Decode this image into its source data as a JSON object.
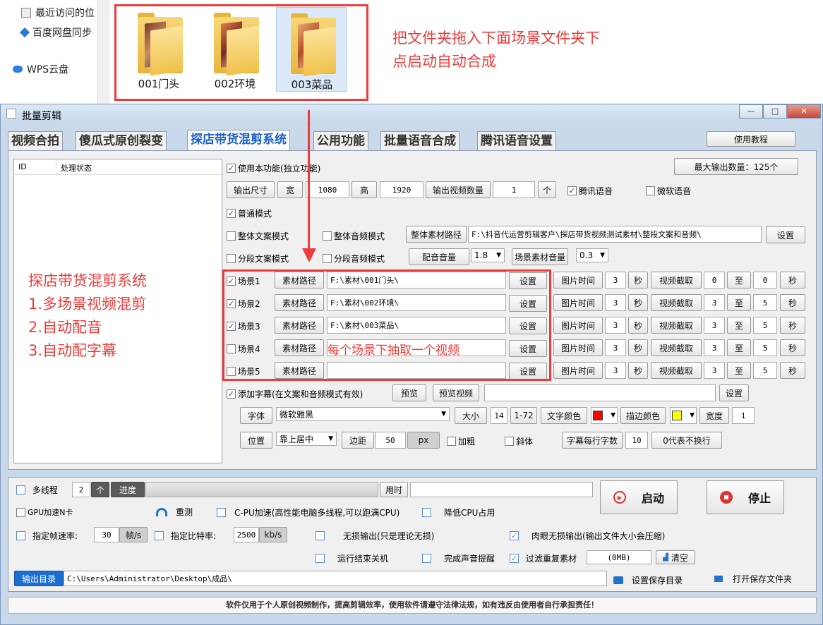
{
  "explorer": {
    "nav": [
      {
        "label": "最近访问的位"
      },
      {
        "label": "百度网盘同步"
      },
      {
        "label": "WPS云盘"
      }
    ],
    "folders": [
      {
        "label": "001门头"
      },
      {
        "label": "002环境"
      },
      {
        "label": "003菜品"
      }
    ]
  },
  "annotations": {
    "top_line1": "把文件夹拖入下面场景文件夹下",
    "top_line2": "点启动自动合成",
    "left_line1": "探店带货混剪系统",
    "left_line2": "1.多场景视频混剪",
    "left_line3": "2.自动配音",
    "left_line4": "3.自动配字幕",
    "scene_note": "每个场景下抽取一个视频"
  },
  "window": {
    "title": "批量剪辑",
    "controls": [
      "—",
      "□",
      "✕"
    ]
  },
  "tabs": [
    {
      "label": "视频合拍"
    },
    {
      "label": "傻瓜式原创裂变"
    },
    {
      "label": "探店带货混剪系统"
    },
    {
      "label": "公用功能"
    },
    {
      "label": "批量语音合成"
    },
    {
      "label": "腾讯语音设置"
    }
  ],
  "tutorial_button": "使用教程",
  "list": {
    "col_id": "ID",
    "col_status": "处理状态"
  },
  "main": {
    "enable_label": "使用本功能(独立功能)",
    "max_output": "最大输出数量：125个",
    "output_size": "输出尺寸",
    "width_label": "宽",
    "width_value": "1080",
    "height_label": "高",
    "height_value": "1920",
    "video_count_label": "输出视频数量",
    "video_count_value": "1",
    "count_unit": "个",
    "tencent_voice": "腾讯语音",
    "ms_voice": "微软语音",
    "normal_mode": "普通模式",
    "whole_text_mode": "整体文案模式",
    "whole_audio_mode": "整体音频模式",
    "whole_path_btn": "整体素材路径",
    "whole_path_value": "F:\\抖音代运营剪辑客户\\探店带货视频测试素材\\整段文案和音频\\",
    "settings": "设置",
    "seg_text_mode": "分段文案模式",
    "seg_audio_mode": "分段音频模式",
    "dub_volume": "配音音量",
    "dub_volume_value": "1.8",
    "scene_volume": "场景素材音量",
    "scene_volume_value": "0.3"
  },
  "scenes": [
    {
      "label": "场景1",
      "checked": true,
      "path": "F:\\素材\\001门头\\",
      "img_time": "3",
      "cut_from": "0",
      "cut_to": "0"
    },
    {
      "label": "场景2",
      "checked": true,
      "path": "F:\\素材\\002环境\\",
      "img_time": "3",
      "cut_from": "3",
      "cut_to": "5"
    },
    {
      "label": "场景3",
      "checked": true,
      "path": "F:\\素材\\003菜品\\",
      "img_time": "3",
      "cut_from": "3",
      "cut_to": "5"
    },
    {
      "label": "场景4",
      "checked": false,
      "path": "",
      "img_time": "3",
      "cut_from": "3",
      "cut_to": "5"
    },
    {
      "label": "场景5",
      "checked": false,
      "path": "",
      "img_time": "3",
      "cut_from": "3",
      "cut_to": "5"
    }
  ],
  "scene_labels": {
    "path_btn": "素材路径",
    "settings": "设置",
    "img_time": "图片时间",
    "sec": "秒",
    "video_cut": "视频截取",
    "to": "至"
  },
  "subtitle": {
    "add_label": "添加字幕(在文案和音频模式有效)",
    "preview": "预览",
    "preview_video": "预览视频",
    "settings": "设置",
    "font_btn": "字体",
    "font_value": "微软雅黑",
    "size_btn": "大小",
    "size_value": "14",
    "size_range": "1-72",
    "text_color": "文字颜色",
    "text_color_hex": "#ff0000",
    "stroke_color": "描边颜色",
    "stroke_color_hex": "#ffff00",
    "width_btn": "宽度",
    "width_value": "1",
    "position_btn": "位置",
    "position_value": "靠上居中",
    "margin_btn": "边距",
    "margin_value": "50",
    "margin_unit": "px",
    "bold": "加粗",
    "italic": "斜体",
    "chars_per_line": "字幕每行字数",
    "chars_value": "10",
    "no_wrap_hint": "0代表不换行"
  },
  "bottom": {
    "multithread": "多线程",
    "threads": "2",
    "threads_unit": "个",
    "progress": "进度",
    "time_used": "用时",
    "start": "启动",
    "stop": "停止",
    "gpu": "GPU加速N卡",
    "retest": "重测",
    "cpu": "C-PU加速(高性能电脑多线程,可以跑满CPU)",
    "low_cpu": "降低CPU占用",
    "fps_label": "指定帧速率:",
    "fps_value": "30",
    "fps_unit": "帧/s",
    "bitrate_label": "指定比特率:",
    "bitrate_value": "2500",
    "bitrate_unit": "kb/s",
    "lossless": "无损输出(只是理论无损)",
    "visual_lossless": "肉眼无损输出(输出文件大小会压缩)",
    "shutdown": "运行结束关机",
    "sound_done": "完成声音提醒",
    "filter_dup": "过滤重复素材",
    "size_display": "(0MB)",
    "clear": "清空",
    "output_dir_btn": "输出目录",
    "output_dir": "C:\\Users\\Administrator\\Desktop\\成品\\",
    "set_save_dir": "设置保存目录",
    "open_save_dir": "打开保存文件夹"
  },
  "status_bar": "软件仅用于个人原创视频制作，提高剪辑效率，使用软件请遵守法律法规，如有违反由使用者自行承担责任！"
}
